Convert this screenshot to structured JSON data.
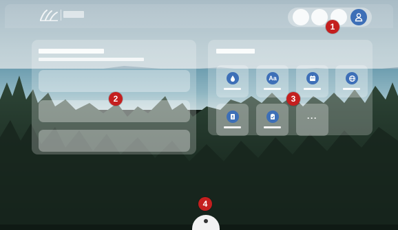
{
  "header": {
    "user_menu": {
      "profile_icon": "user-icon"
    }
  },
  "apps": {
    "tiles": [
      {
        "icon": "water-drop-icon"
      },
      {
        "icon": "font-icon",
        "glyph": "Aa"
      },
      {
        "icon": "calendar-icon"
      },
      {
        "icon": "globe-icon"
      },
      {
        "icon": "contacts-book-icon"
      },
      {
        "icon": "clipboard-check-icon"
      },
      {
        "icon": "more-icon",
        "glyph": "···"
      }
    ]
  },
  "markers": [
    "1",
    "2",
    "3",
    "4"
  ],
  "colors": {
    "accent": "#3d6fb7",
    "marker": "#c41f1f"
  }
}
